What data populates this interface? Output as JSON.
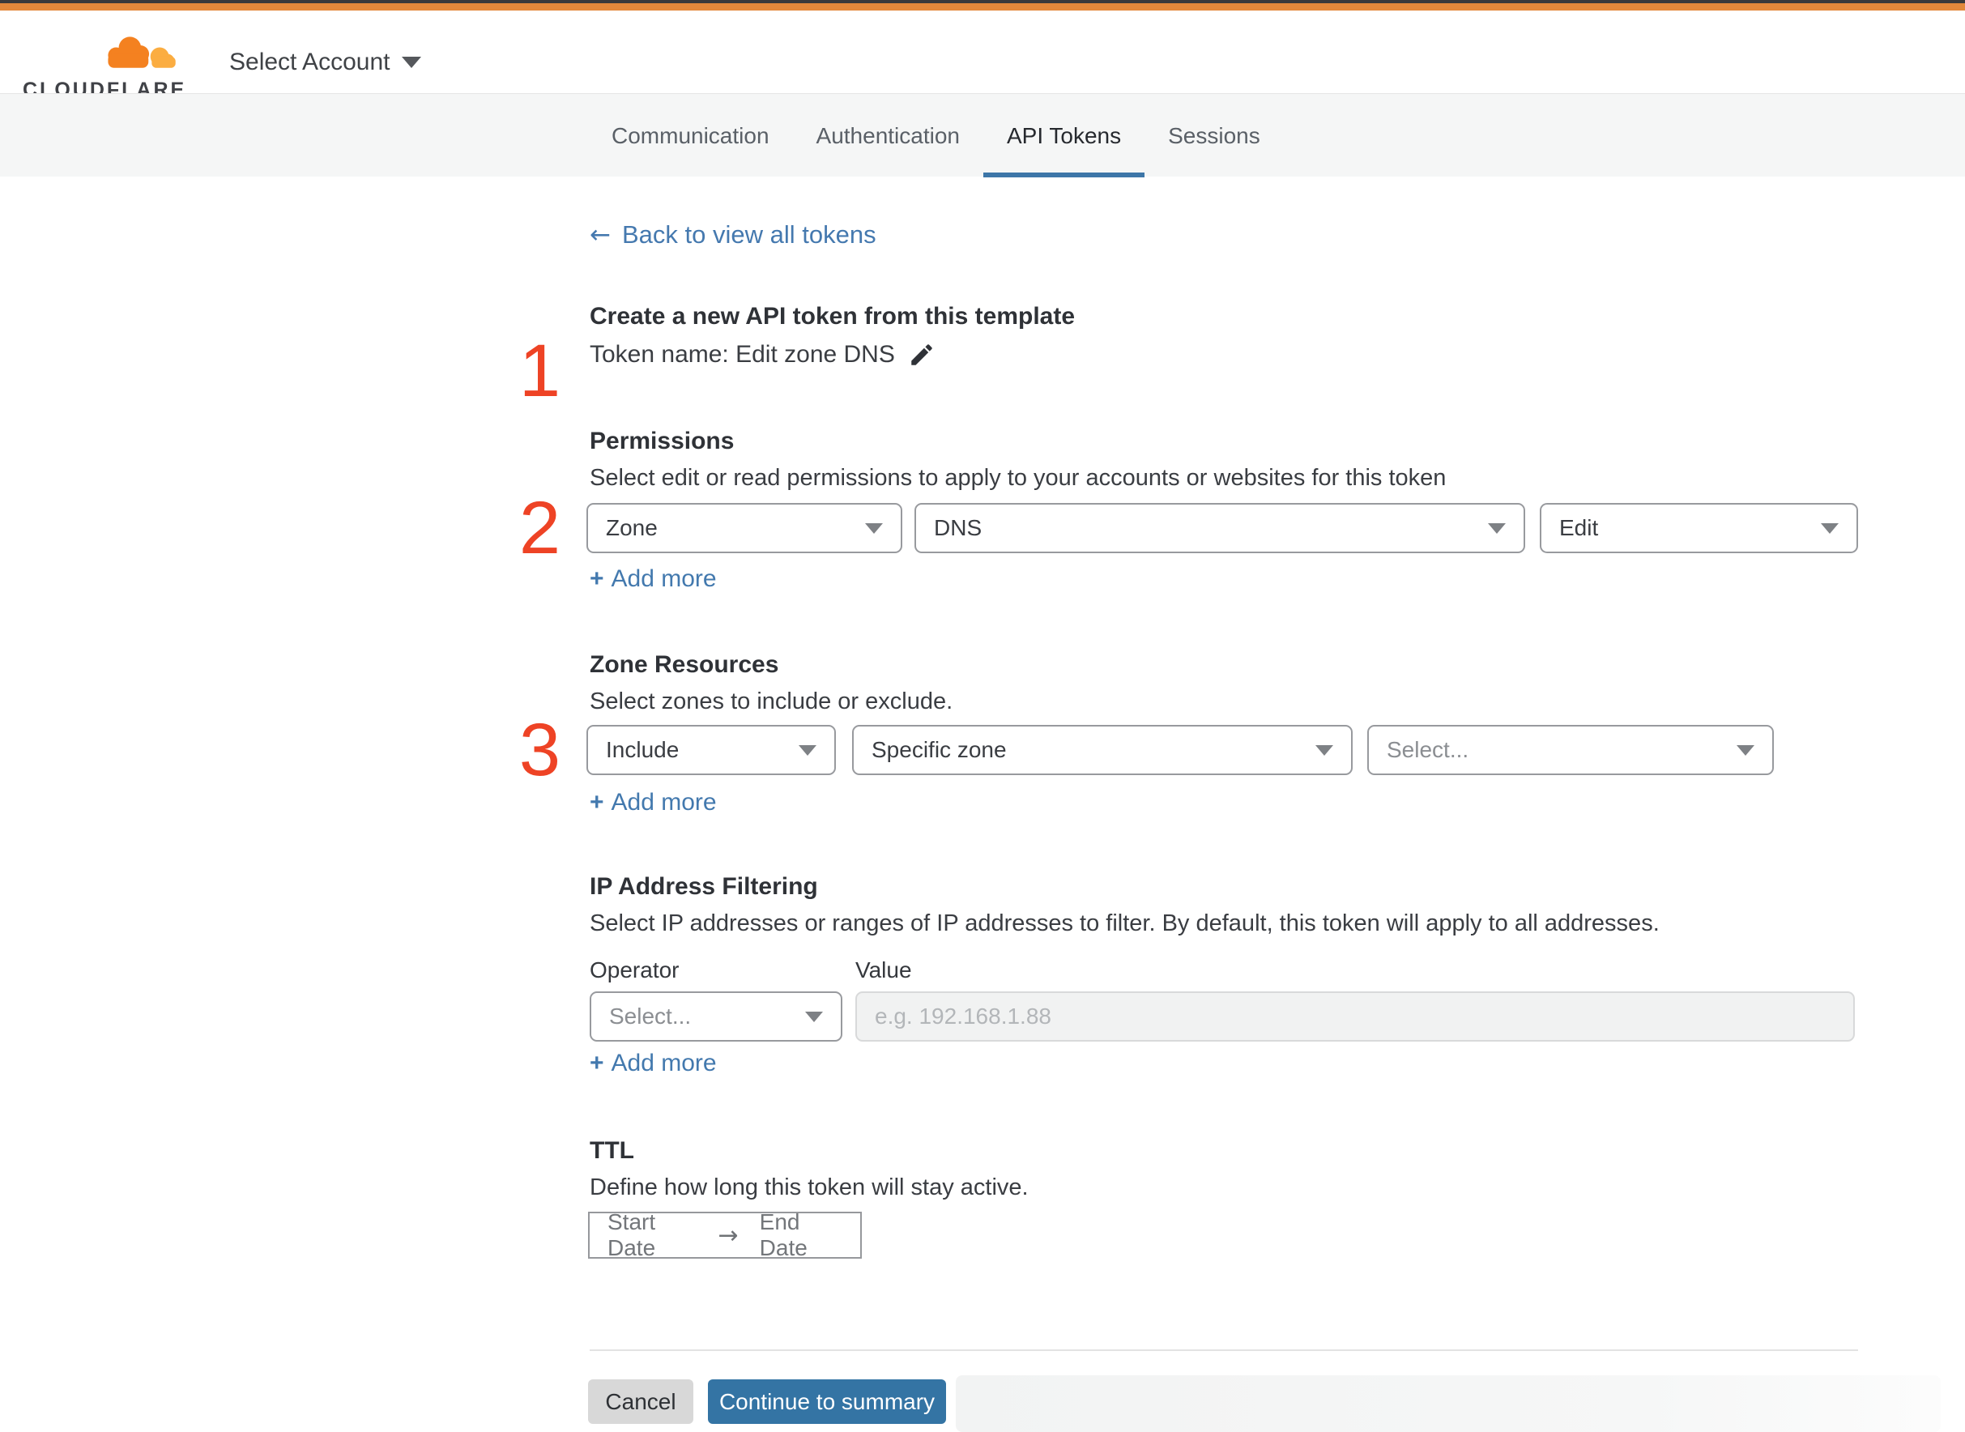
{
  "header": {
    "logo_text": "CLOUDFLARE",
    "account_selector": "Select Account"
  },
  "tabs": [
    {
      "label": "Communication"
    },
    {
      "label": "Authentication"
    },
    {
      "label": "API Tokens"
    },
    {
      "label": "Sessions"
    }
  ],
  "page": {
    "back_arrow": "←",
    "back_link": "Back to view all tokens"
  },
  "sections": {
    "token": {
      "number": "1",
      "title": "Create a new API token from this template",
      "token_name": "Token name: Edit zone DNS"
    },
    "permissions": {
      "number": "2",
      "title": "Permissions",
      "description": "Select edit or read permissions to apply to your accounts or websites for this token",
      "scope": "Zone",
      "permission_group": "DNS",
      "access_level": "Edit",
      "add_more_plus": "+",
      "add_more": "Add more"
    },
    "zone_resources": {
      "number": "3",
      "title": "Zone Resources",
      "description": "Select zones to include or exclude.",
      "operator": "Include",
      "resource_type": "Specific zone",
      "zone_placeholder": "Select...",
      "add_more_plus": "+",
      "add_more": "Add more"
    },
    "ip_filtering": {
      "title": "IP Address Filtering",
      "description": "Select IP addresses or ranges of IP addresses to filter. By default, this token will apply to all addresses.",
      "operator_label": "Operator",
      "value_label": "Value",
      "operator_placeholder": "Select...",
      "value_placeholder": "e.g. 192.168.1.88",
      "add_more_plus": "+",
      "add_more": "Add more"
    },
    "ttl": {
      "title": "TTL",
      "description": "Define how long this token will stay active.",
      "start_date": "Start Date",
      "arrow": "→",
      "end_date": "End Date"
    }
  },
  "footer": {
    "cancel": "Cancel",
    "continue": "Continue to summary"
  },
  "colors": {
    "brand_orange": "#e2883b",
    "logo_orange": "#f48120",
    "logo_orange_light": "#fbad41",
    "accent_blue": "#3474a4",
    "link_blue": "#4579af",
    "step_red": "#ee4325",
    "tab_underline": "#3d76a8",
    "tabbar_bg": "#f5f6f6"
  }
}
